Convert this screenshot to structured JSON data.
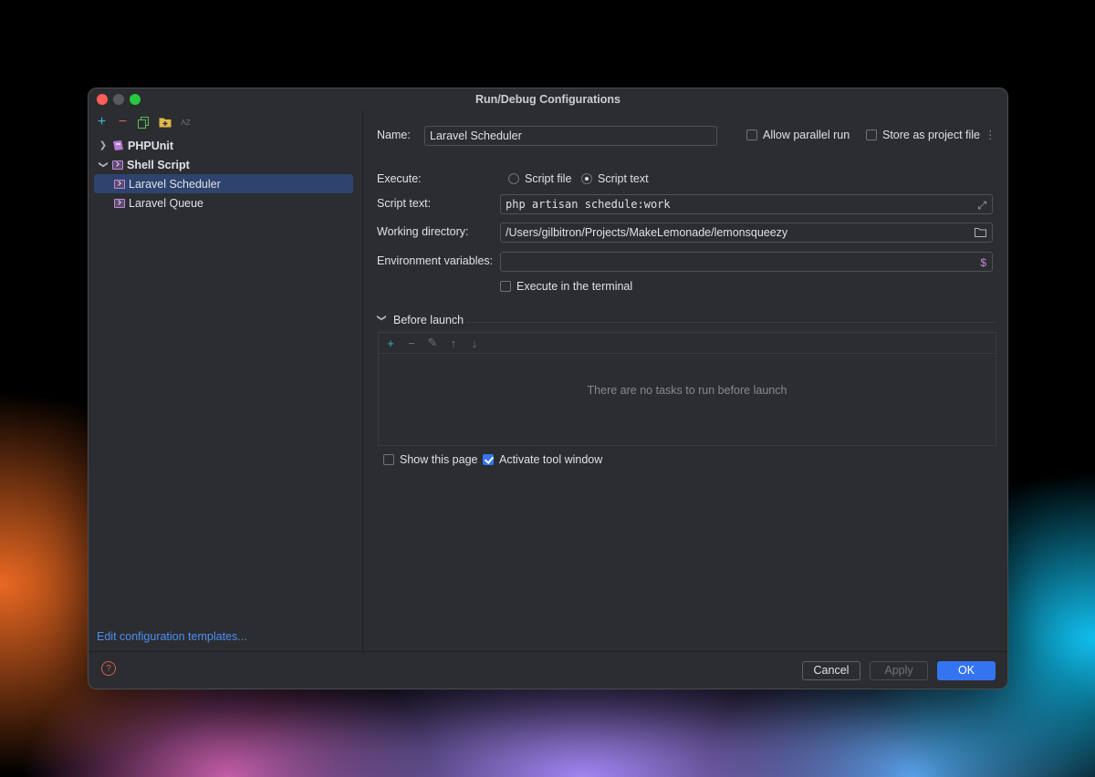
{
  "window": {
    "title": "Run/Debug Configurations"
  },
  "left_toolbar": {
    "add": "+",
    "remove": "−",
    "copy": "⧉",
    "folder": "▣",
    "sort": "AZ"
  },
  "tree": {
    "php_unit": "PHPUnit",
    "shell_script": "Shell Script",
    "laravel_scheduler": "Laravel Scheduler",
    "laravel_queue": "Laravel Queue"
  },
  "left_footer": {
    "edit_templates": "Edit configuration templates..."
  },
  "form": {
    "name_label": "Name:",
    "name_value": "Laravel Scheduler",
    "allow_parallel": "Allow parallel run",
    "store_project": "Store as project file",
    "execute_label": "Execute:",
    "script_file": "Script file",
    "script_text_option": "Script text",
    "script_text_label": "Script text:",
    "script_text_value": "php artisan schedule:work",
    "working_dir_label": "Working directory:",
    "working_dir_value": "/Users/gilbitron/Projects/MakeLemonade/lemonsqueezy",
    "env_label": "Environment variables:",
    "env_value": "",
    "execute_terminal": "Execute in the terminal",
    "selected_execute": "Script text",
    "parallel_checked": false,
    "store_checked": false,
    "terminal_checked": false
  },
  "before_launch": {
    "title": "Before launch",
    "empty_text": "There are no tasks to run before launch",
    "show_page": "Show this page",
    "activate_tool": "Activate tool window",
    "show_page_checked": false,
    "activate_tool_checked": true
  },
  "buttons": {
    "help": "?",
    "cancel": "Cancel",
    "apply": "Apply",
    "ok": "OK"
  },
  "colors": {
    "accent": "#3574f0",
    "link": "#4d8ff3",
    "selection": "#2e436e",
    "help": "#db5c5c"
  }
}
